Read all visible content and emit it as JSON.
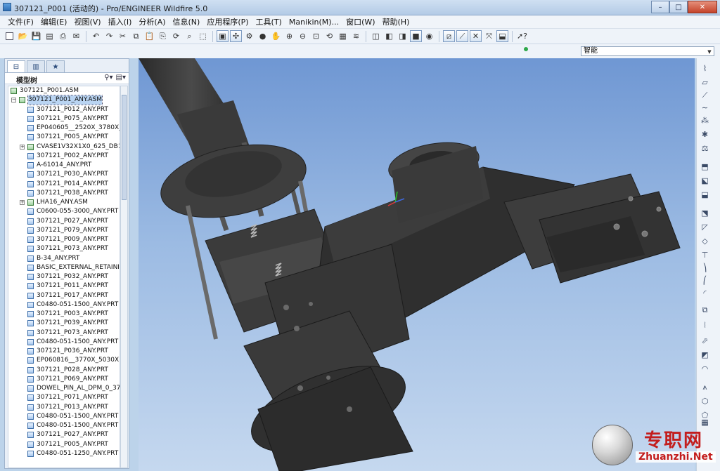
{
  "window": {
    "title": "307121_P001 (活动的) - Pro/ENGINEER Wildfire 5.0",
    "controls": [
      "–",
      "□",
      "✕"
    ]
  },
  "menu": [
    "文件(F)",
    "编辑(E)",
    "视图(V)",
    "插入(I)",
    "分析(A)",
    "信息(N)",
    "应用程序(P)",
    "工具(T)",
    "Manikin(M)...",
    "窗口(W)",
    "帮助(H)"
  ],
  "selection_filter": {
    "value": "智能"
  },
  "model_tree": {
    "header": "模型树",
    "root": "307121_P001.ASM",
    "sub_assembly": "307121_P001_ANY.ASM",
    "items": [
      "307121_P012_ANY.PRT",
      "307121_P075_ANY.PRT",
      "EP040605__2520X_3780X_313_",
      "307121_P005_ANY.PRT",
      "CVASE1V32X1X0_625_DB15_L",
      "307121_P002_ANY.PRT",
      "A-61014_ANY.PRT",
      "307121_P030_ANY.PRT",
      "307121_P014_ANY.PRT",
      "307121_P038_ANY.PRT",
      "LHA16_ANY.ASM",
      "C0600-055-3000_ANY.PRT",
      "307121_P027_ANY.PRT",
      "307121_P079_ANY.PRT",
      "307121_P009_ANY.PRT",
      "307121_P073_ANY.PRT",
      "B-34_ANY.PRT",
      "BASIC_EXTERNAL_RETAINING",
      "307121_P032_ANY.PRT",
      "307121_P011_ANY.PRT",
      "307121_P017_ANY.PRT",
      "C0480-051-1500_ANY.PRT",
      "307121_P003_ANY.PRT",
      "307121_P039_ANY.PRT",
      "307121_P073_ANY.PRT",
      "C0480-051-1500_ANY.PRT",
      "307121_P036_ANY.PRT",
      "EP060816__3770X_5030X1_00",
      "307121_P028_ANY.PRT",
      "307121_P069_ANY.PRT",
      "DOWEL_PIN_AL_DPM_0_375X1",
      "307121_P071_ANY.PRT",
      "307121_P013_ANY.PRT",
      "C0480-051-1500_ANY.PRT",
      "C0480-051-1500_ANY.PRT",
      "307121_P027_ANY.PRT",
      "307121_P005_ANY.PRT",
      "C0480-051-1250_ANY.PRT"
    ]
  },
  "watermark": {
    "cn": "专职网",
    "en": "Zhuanzhi.Net"
  },
  "colors": {
    "viewport_top": "#6f97d3",
    "viewport_bottom": "#c5d8ef",
    "model": "#3a3a3a",
    "watermark": "#c31d1d"
  }
}
